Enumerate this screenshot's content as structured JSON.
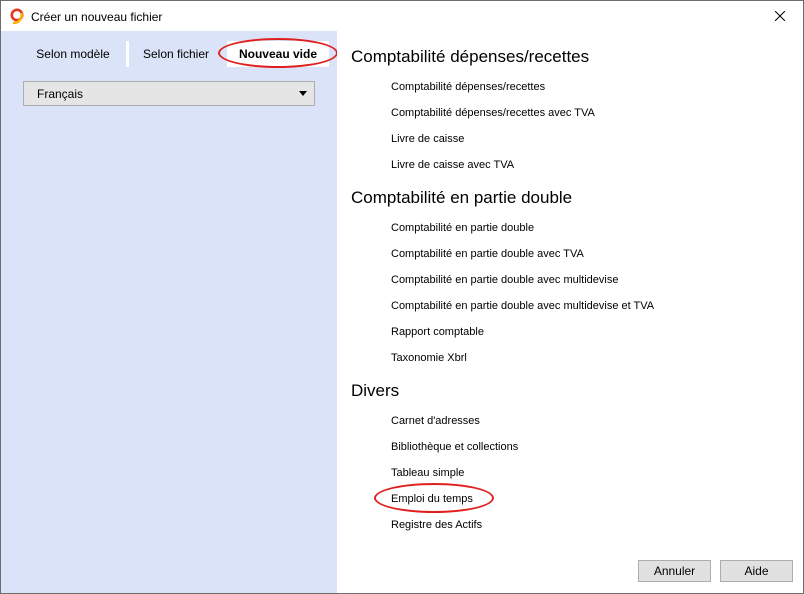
{
  "window": {
    "title": "Créer un nouveau fichier"
  },
  "tabs": [
    {
      "label": "Selon modèle"
    },
    {
      "label": "Selon fichier"
    },
    {
      "label": "Nouveau vide",
      "active": true
    }
  ],
  "language_select": {
    "value": "Français"
  },
  "sections": [
    {
      "heading": "Comptabilité dépenses/recettes",
      "items": [
        "Comptabilité dépenses/recettes",
        "Comptabilité dépenses/recettes avec TVA",
        "Livre de caisse",
        "Livre de caisse avec TVA"
      ]
    },
    {
      "heading": "Comptabilité en partie double",
      "items": [
        "Comptabilité en partie double",
        "Comptabilité en partie double avec TVA",
        "Comptabilité en partie double avec multidevise",
        "Comptabilité en partie double avec multidevise et TVA",
        "Rapport comptable",
        "Taxonomie Xbrl"
      ]
    },
    {
      "heading": "Divers",
      "items": [
        "Carnet d'adresses",
        "Bibliothèque et collections",
        "Tableau simple",
        "Emploi du temps",
        "Registre des Actifs"
      ]
    }
  ],
  "buttons": {
    "cancel": "Annuler",
    "help": "Aide"
  },
  "colors": {
    "left_pane": "#dae3f7",
    "highlight": "#e0201f"
  },
  "icons": {
    "app": "banana-logo-icon",
    "close": "close-icon",
    "dropdown": "dropdown-arrow-icon"
  }
}
